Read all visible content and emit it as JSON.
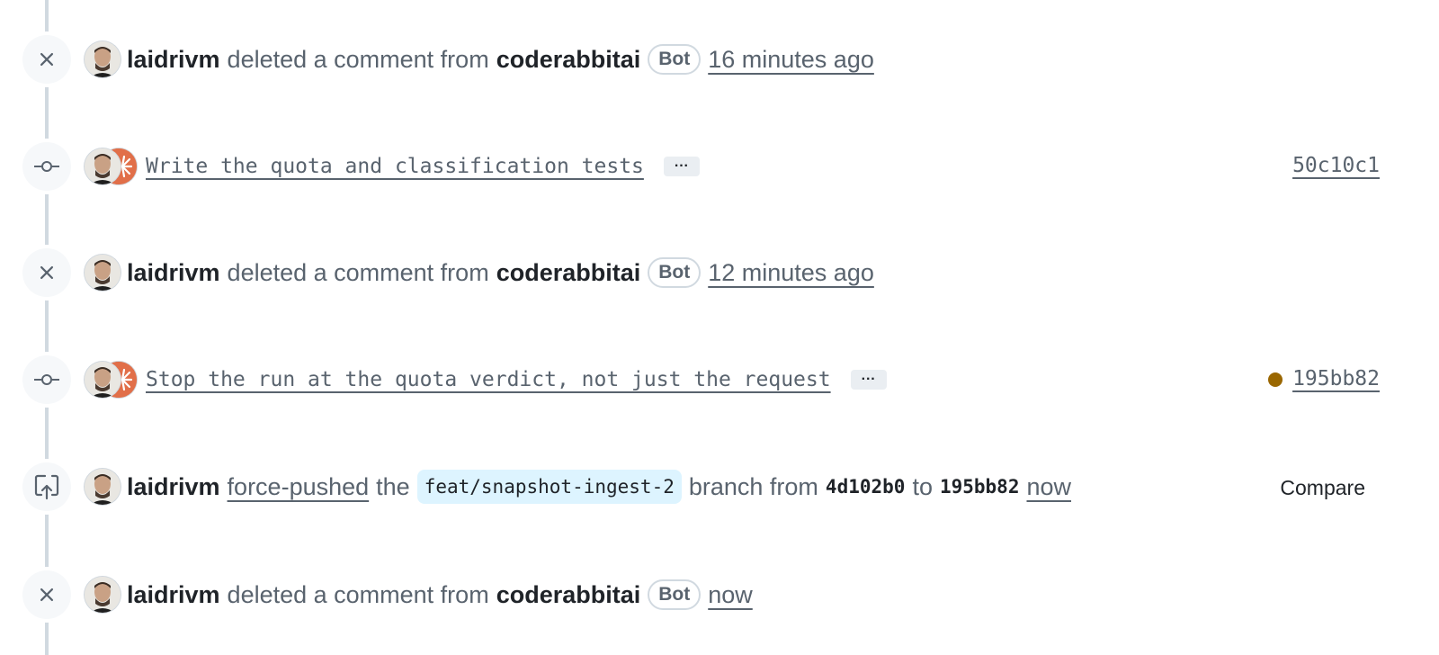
{
  "colors": {
    "accent_dot": "#9a6700",
    "branch_bg": "#ddf4ff",
    "muted": "#59636e",
    "line": "#d1d9e0"
  },
  "events": {
    "e1": {
      "icon": "close-icon",
      "author": "laidrivm",
      "action": "deleted a comment from",
      "target": "coderabbitai",
      "badge": "Bot",
      "time": "16 minutes ago"
    },
    "e2": {
      "icon": "git-commit-icon",
      "message": "Write the quota and classification tests",
      "ellipsis": "···",
      "sha": "50c10c1"
    },
    "e3": {
      "icon": "close-icon",
      "author": "laidrivm",
      "action": "deleted a comment from",
      "target": "coderabbitai",
      "badge": "Bot",
      "time": "12 minutes ago"
    },
    "e4": {
      "icon": "git-commit-icon",
      "message": "Stop the run at the quota verdict, not just the request",
      "ellipsis": "···",
      "sha": "195bb82",
      "status": "pending-dot"
    },
    "e5": {
      "icon": "repo-push-icon",
      "author": "laidrivm",
      "action": "force-pushed",
      "the": "the",
      "branch": "feat/snapshot-ingest-2",
      "branch_from": "branch from",
      "from_sha": "4d102b0",
      "to": "to",
      "to_sha": "195bb82",
      "time": "now",
      "compare": "Compare"
    },
    "e6": {
      "icon": "close-icon",
      "author": "laidrivm",
      "action": "deleted a comment from",
      "target": "coderabbitai",
      "badge": "Bot",
      "time": "now"
    }
  }
}
